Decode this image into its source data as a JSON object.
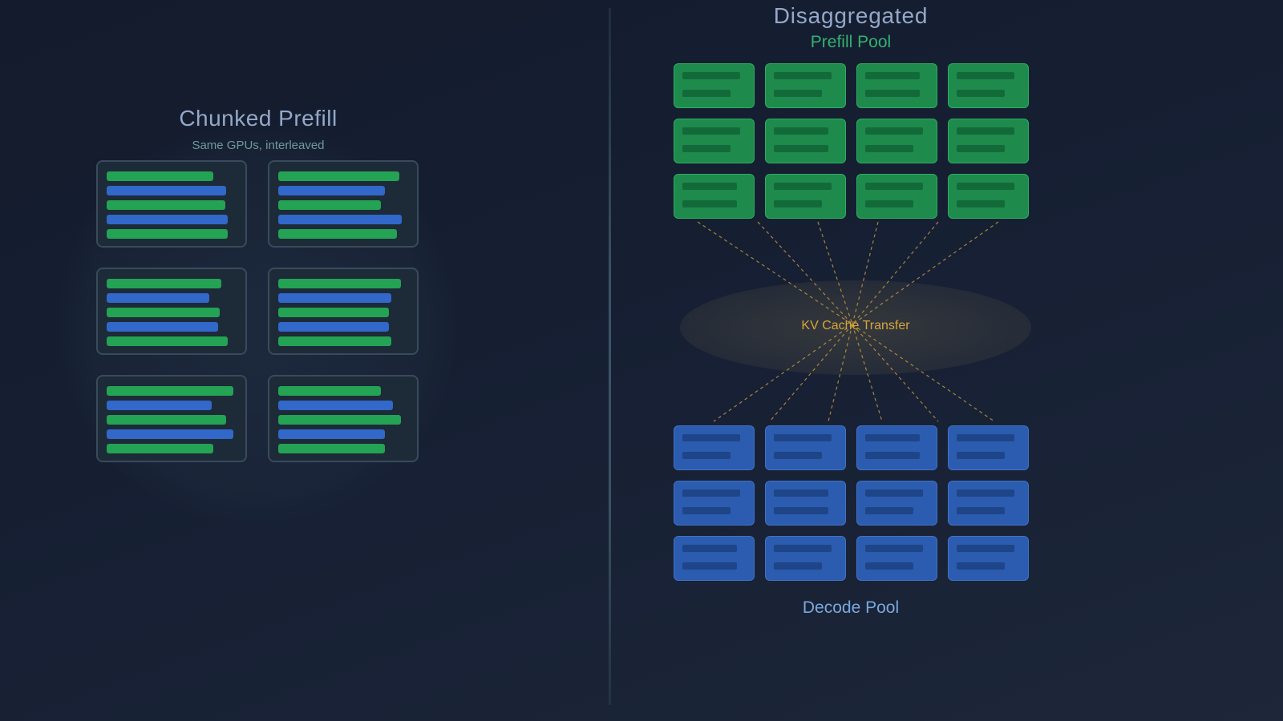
{
  "left_panel": {
    "title": "Chunked Prefill",
    "subtitle": "Same GPUs, interleaved",
    "cards": [
      {
        "bars": [
          {
            "kind": "prefill",
            "fill": 0.8
          },
          {
            "kind": "decode",
            "fill": 0.9
          },
          {
            "kind": "prefill",
            "fill": 0.89
          },
          {
            "kind": "decode",
            "fill": 0.91
          },
          {
            "kind": "prefill",
            "fill": 0.91
          }
        ]
      },
      {
        "bars": [
          {
            "kind": "prefill",
            "fill": 0.91
          },
          {
            "kind": "decode",
            "fill": 0.8
          },
          {
            "kind": "prefill",
            "fill": 0.77
          },
          {
            "kind": "decode",
            "fill": 0.93
          },
          {
            "kind": "prefill",
            "fill": 0.89
          }
        ]
      },
      {
        "bars": [
          {
            "kind": "prefill",
            "fill": 0.86
          },
          {
            "kind": "decode",
            "fill": 0.77
          },
          {
            "kind": "prefill",
            "fill": 0.85
          },
          {
            "kind": "decode",
            "fill": 0.84
          },
          {
            "kind": "prefill",
            "fill": 0.91
          }
        ]
      },
      {
        "bars": [
          {
            "kind": "prefill",
            "fill": 0.92
          },
          {
            "kind": "decode",
            "fill": 0.85
          },
          {
            "kind": "prefill",
            "fill": 0.83
          },
          {
            "kind": "decode",
            "fill": 0.83
          },
          {
            "kind": "prefill",
            "fill": 0.85
          }
        ]
      },
      {
        "bars": [
          {
            "kind": "prefill",
            "fill": 0.95
          },
          {
            "kind": "decode",
            "fill": 0.79
          },
          {
            "kind": "prefill",
            "fill": 0.9
          },
          {
            "kind": "decode",
            "fill": 0.95
          },
          {
            "kind": "prefill",
            "fill": 0.8
          }
        ]
      },
      {
        "bars": [
          {
            "kind": "prefill",
            "fill": 0.77
          },
          {
            "kind": "decode",
            "fill": 0.86
          },
          {
            "kind": "prefill",
            "fill": 0.92
          },
          {
            "kind": "decode",
            "fill": 0.8
          },
          {
            "kind": "prefill",
            "fill": 0.8
          }
        ]
      }
    ]
  },
  "right_panel": {
    "title": "Disaggregated",
    "prefill_pool_label": "Prefill Pool",
    "decode_pool_label": "Decode Pool",
    "transfer_label": "KV Cache Transfer",
    "prefill_rows": 3,
    "decode_rows": 3,
    "columns": 4
  },
  "colors": {
    "prefill": "#23a353",
    "decode": "#3168c9",
    "transfer": "#d6a53c",
    "prefill_node": "#1e8a4c",
    "decode_node": "#2c5caf"
  }
}
